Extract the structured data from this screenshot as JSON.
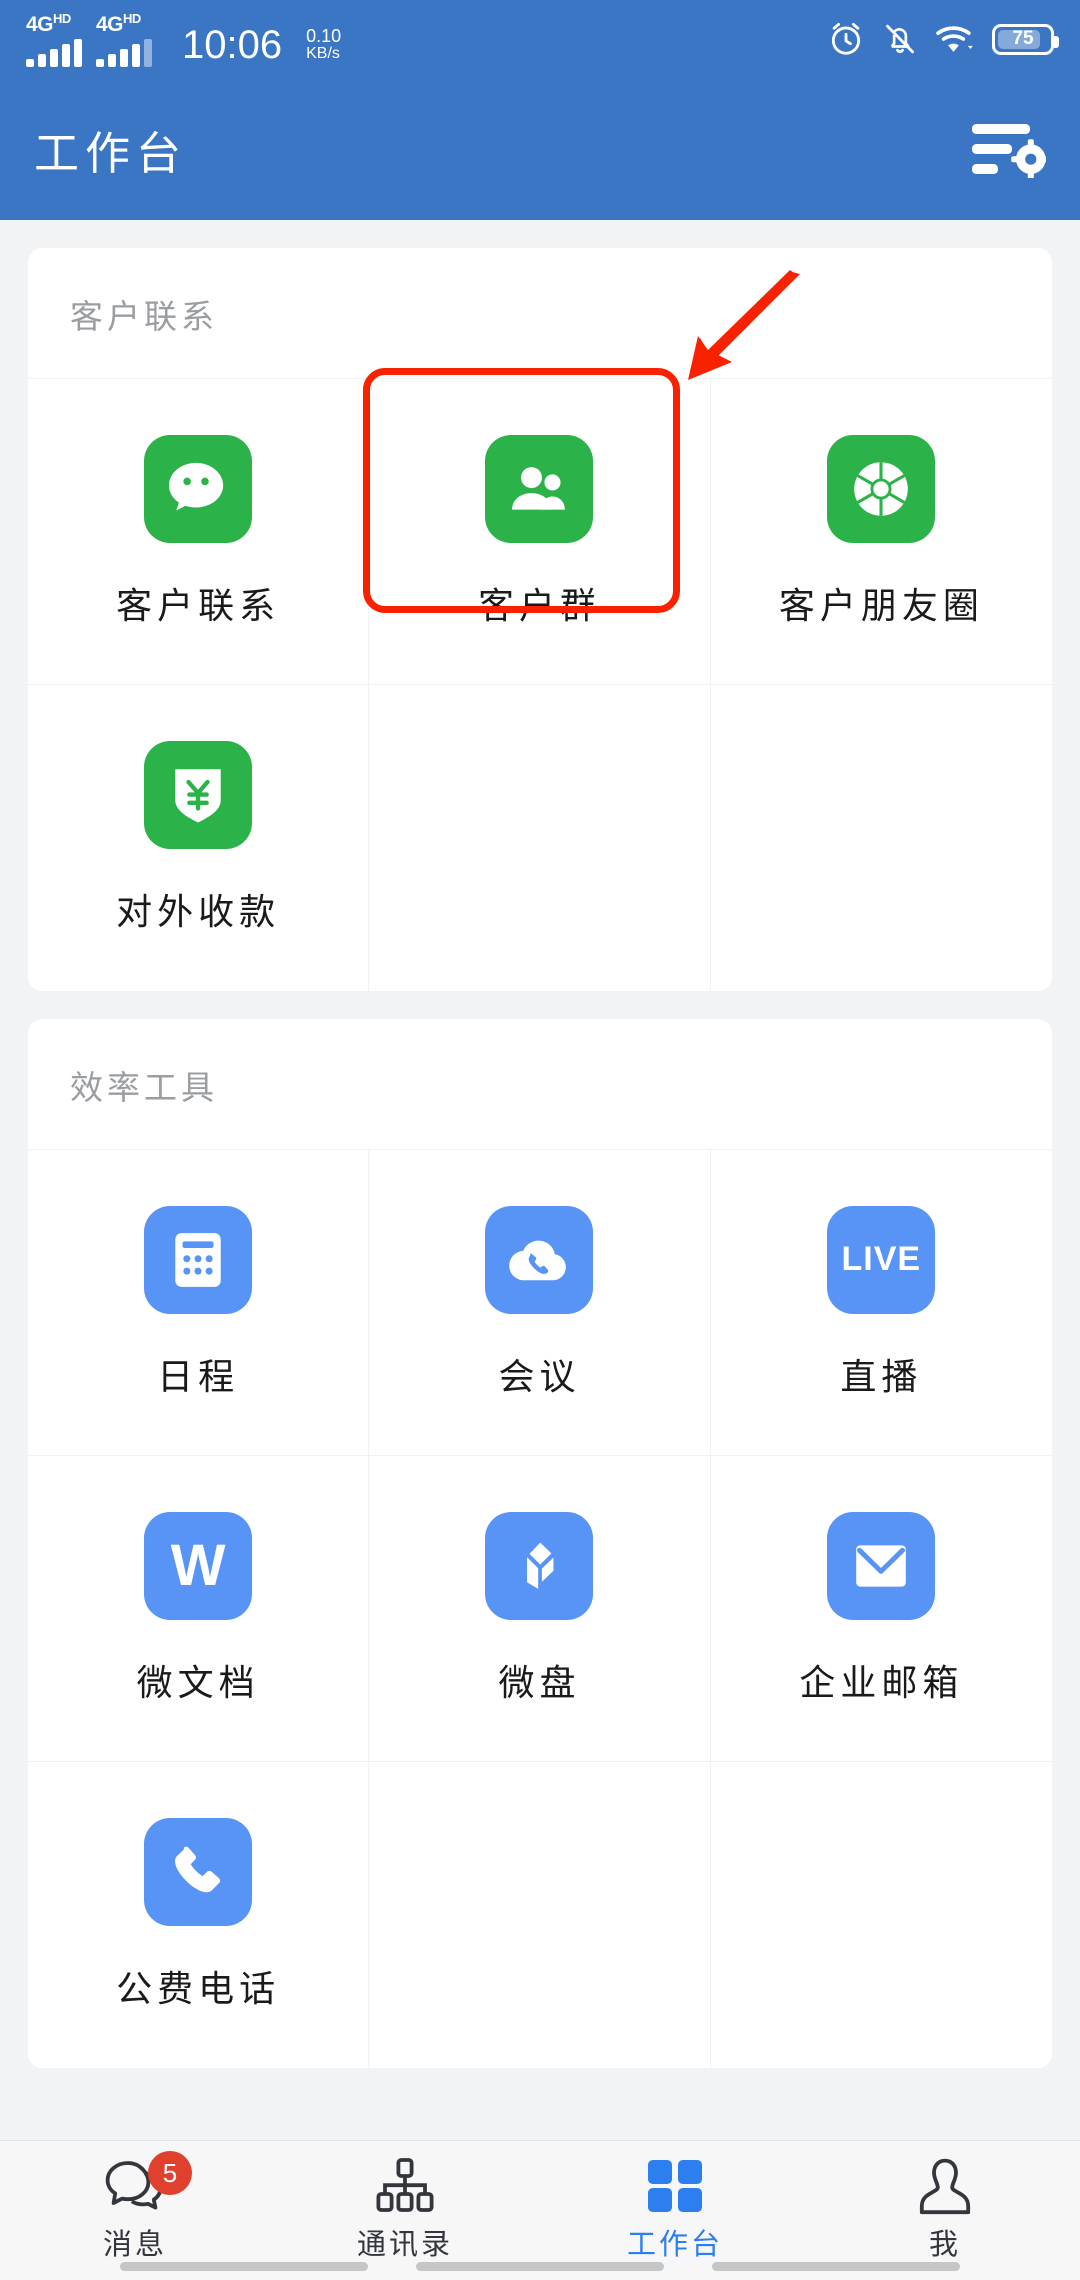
{
  "status_bar": {
    "signal_1": {
      "network": "4G",
      "suffix": "HD"
    },
    "signal_2": {
      "network": "4G",
      "suffix": "HD"
    },
    "time": "10:06",
    "net_speed_value": "0.10",
    "net_speed_unit": "KB/s",
    "icons": [
      "alarm-icon",
      "bell-muted-icon",
      "wifi-icon",
      "battery-icon"
    ],
    "battery_percent": "75"
  },
  "header": {
    "title": "工作台",
    "manage_icon": "list-settings-icon",
    "background_color": "#3a76c4"
  },
  "sections": [
    {
      "title": "客户联系",
      "items": [
        {
          "label": "客户联系",
          "icon": "wechat-bubble-icon",
          "color": "#2bb34a",
          "highlighted": false
        },
        {
          "label": "客户群",
          "icon": "group-people-icon",
          "color": "#2bb34a",
          "highlighted": true
        },
        {
          "label": "客户朋友圈",
          "icon": "aperture-icon",
          "color": "#2bb34a",
          "highlighted": false
        },
        {
          "label": "对外收款",
          "icon": "shield-yuan-icon",
          "color": "#2bb34a",
          "highlighted": false
        }
      ]
    },
    {
      "title": "效率工具",
      "items": [
        {
          "label": "日程",
          "icon": "calendar-icon",
          "color": "#5894f5",
          "highlighted": false
        },
        {
          "label": "会议",
          "icon": "cloud-phone-icon",
          "color": "#5894f5",
          "highlighted": false
        },
        {
          "label": "直播",
          "icon": "live-text-icon",
          "color": "#5894f5",
          "highlighted": false,
          "glyph_text": "LIVE"
        },
        {
          "label": "微文档",
          "icon": "w-doc-icon",
          "color": "#5894f5",
          "highlighted": false,
          "glyph_text": "W"
        },
        {
          "label": "微盘",
          "icon": "cube-drive-icon",
          "color": "#5894f5",
          "highlighted": false
        },
        {
          "label": "企业邮箱",
          "icon": "envelope-icon",
          "color": "#5894f5",
          "highlighted": false
        },
        {
          "label": "公费电话",
          "icon": "phone-icon",
          "color": "#5894f5",
          "highlighted": false
        }
      ]
    }
  ],
  "annotations": {
    "highlight_color": "#f92200",
    "highlight_target": "客户群",
    "arrow_color": "#f92200",
    "arrow_direction": "down-left"
  },
  "tabbar": {
    "items": [
      {
        "label": "消息",
        "icon": "chat-bubbles-icon",
        "badge": "5",
        "active": false
      },
      {
        "label": "通讯录",
        "icon": "org-tree-icon",
        "badge": "",
        "active": false
      },
      {
        "label": "工作台",
        "icon": "grid-squares-icon",
        "badge": "",
        "active": true
      },
      {
        "label": "我",
        "icon": "person-icon",
        "badge": "",
        "active": false
      }
    ],
    "active_color": "#2d7ff0"
  }
}
